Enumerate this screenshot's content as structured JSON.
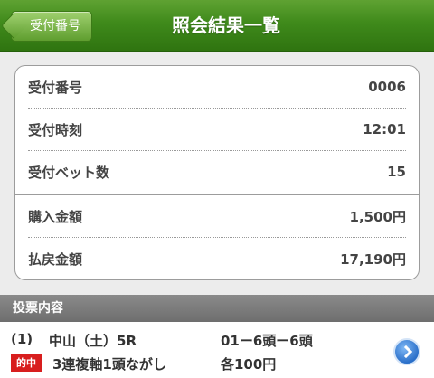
{
  "header": {
    "back_label": "受付番号",
    "title": "照会結果一覧"
  },
  "summary": {
    "rows": [
      {
        "label": "受付番号",
        "value": "0006"
      },
      {
        "label": "受付時刻",
        "value": "12:01"
      },
      {
        "label": "受付ベット数",
        "value": "15"
      },
      {
        "label": "購入金額",
        "value": "1,500円"
      },
      {
        "label": "払戻金額",
        "value": "17,190円"
      }
    ]
  },
  "section": {
    "title": "投票内容"
  },
  "bets": [
    {
      "index": "(1)",
      "race": "中山（土）5R",
      "numbers": "01ー6頭ー6頭",
      "badge": "的中",
      "type": "3連複軸1頭ながし",
      "amount": "各100円"
    }
  ],
  "colors": {
    "header_green": "#3f8a1b",
    "hit_red": "#d81e1e",
    "arrow_blue": "#2a6fc9"
  }
}
